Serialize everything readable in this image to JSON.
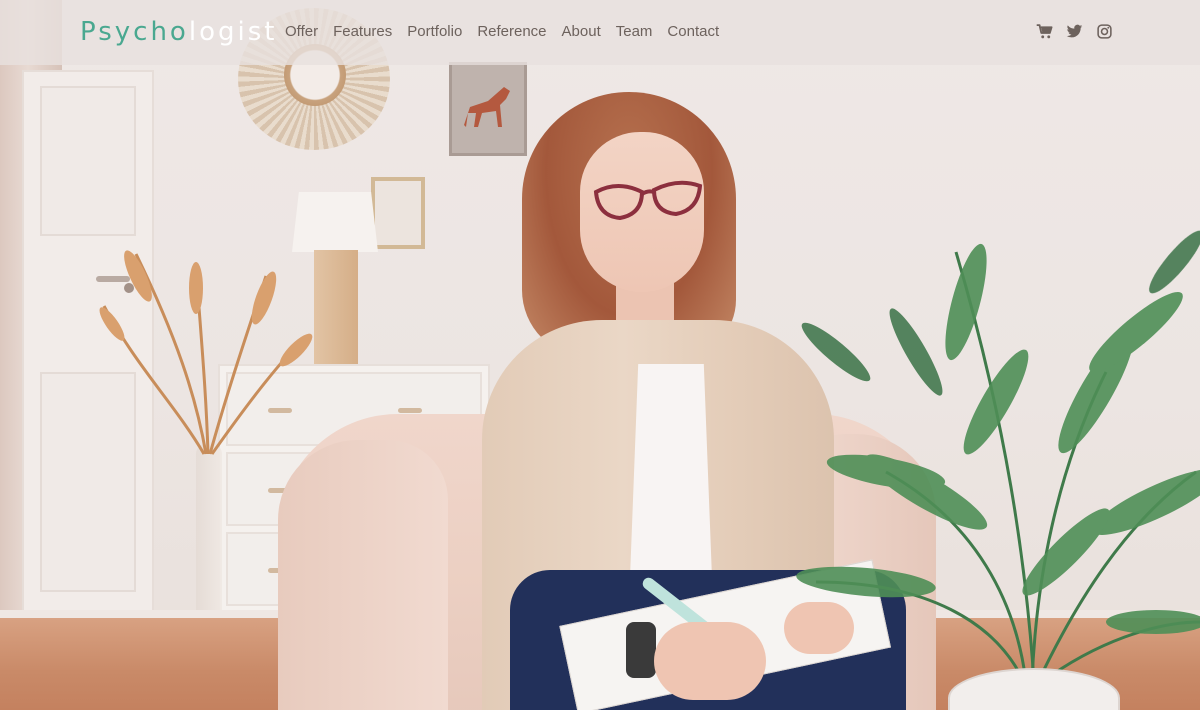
{
  "header": {
    "logo_accent": "Psycho",
    "logo_rest": "logist",
    "nav": [
      {
        "label": "Offer"
      },
      {
        "label": "Features"
      },
      {
        "label": "Portfolio"
      },
      {
        "label": "Reference"
      },
      {
        "label": "About"
      },
      {
        "label": "Team"
      },
      {
        "label": "Contact"
      }
    ],
    "icons": [
      "cart-icon",
      "twitter-icon",
      "instagram-icon"
    ]
  },
  "colors": {
    "accent": "#4aa890",
    "nav_text": "#6d625d",
    "header_bg": "#e8e0de"
  },
  "hero": {
    "image_subject": "psychologist-in-armchair-photo"
  }
}
